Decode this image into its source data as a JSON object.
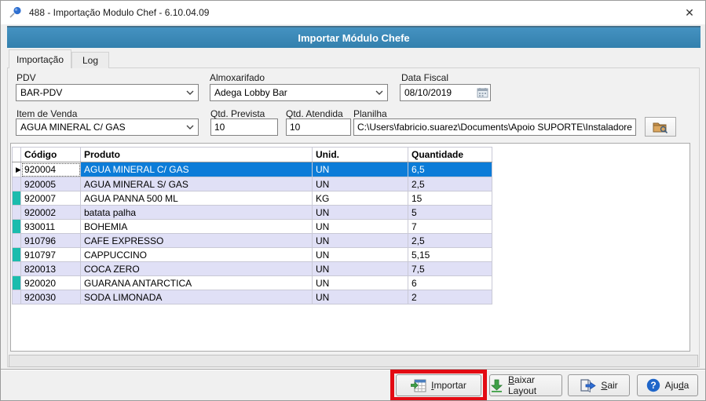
{
  "window": {
    "title": "488 - Importação Modulo Chef - 6.10.04.09",
    "close_glyph": "✕"
  },
  "header": {
    "title": "Importar Módulo Chefe"
  },
  "tabs": [
    {
      "label": "Importação",
      "active": true
    },
    {
      "label": "Log",
      "active": false
    }
  ],
  "form": {
    "pdv": {
      "label": "PDV",
      "value": "BAR-PDV"
    },
    "almoxarifado": {
      "label": "Almoxarifado",
      "value": "Adega Lobby Bar"
    },
    "data_fiscal": {
      "label": "Data Fiscal",
      "value": "08/10/2019"
    },
    "item_venda": {
      "label": "Item de Venda",
      "value": "AGUA MINERAL C/ GAS"
    },
    "qtd_prevista": {
      "label": "Qtd. Prevista",
      "value": "10"
    },
    "qtd_atendida": {
      "label": "Qtd. Atendida",
      "value": "10"
    },
    "planilha": {
      "label": "Planilha",
      "value": "C:\\Users\\fabricio.suarez\\Documents\\Apoio SUPORTE\\Instaladores\\Mó"
    }
  },
  "table": {
    "columns": [
      "Código",
      "Produto",
      "Unid.",
      "Quantidade"
    ],
    "selected_index": 0,
    "rows": [
      {
        "codigo": "920004",
        "produto": "AGUA MINERAL C/ GAS",
        "unid": "UN",
        "quantidade": "6,5"
      },
      {
        "codigo": "920005",
        "produto": "AGUA MINERAL S/ GAS",
        "unid": "UN",
        "quantidade": "2,5"
      },
      {
        "codigo": "920007",
        "produto": "AGUA PANNA 500 ML",
        "unid": "KG",
        "quantidade": "15"
      },
      {
        "codigo": "920002",
        "produto": "batata palha",
        "unid": "UN",
        "quantidade": "5"
      },
      {
        "codigo": "930011",
        "produto": "BOHEMIA",
        "unid": "UN",
        "quantidade": "7"
      },
      {
        "codigo": "910796",
        "produto": "CAFE EXPRESSO",
        "unid": "UN",
        "quantidade": "2,5"
      },
      {
        "codigo": "910797",
        "produto": "CAPPUCCINO",
        "unid": "UN",
        "quantidade": "5,15"
      },
      {
        "codigo": "820013",
        "produto": "COCA ZERO",
        "unid": "UN",
        "quantidade": "7,5"
      },
      {
        "codigo": "920020",
        "produto": "GUARANA ANTARCTICA",
        "unid": "UN",
        "quantidade": "6"
      },
      {
        "codigo": "920030",
        "produto": "SODA LIMONADA",
        "unid": "UN",
        "quantidade": "2"
      }
    ]
  },
  "buttons": {
    "importar": {
      "pre": "",
      "key": "I",
      "post": "mportar"
    },
    "baixar": {
      "pre": "",
      "key": "B",
      "post": "aixar Layout"
    },
    "sair": {
      "pre": "",
      "key": "S",
      "post": "air"
    },
    "ajuda": {
      "pre": "Aju",
      "key": "d",
      "post": "a"
    }
  },
  "colors": {
    "header_blue": "#4592c1",
    "header_blue_dark": "#3380ad",
    "sel_blue": "#0c7cd8",
    "stripe": "#e0e0f6",
    "teal": "#1bbcad",
    "highlight_red": "#e30b13"
  }
}
